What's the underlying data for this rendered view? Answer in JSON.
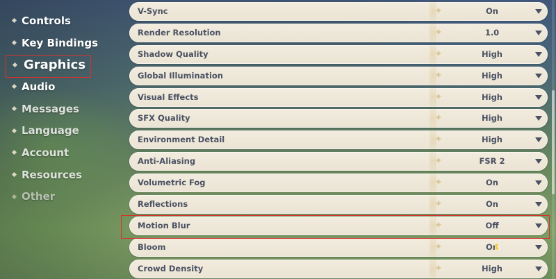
{
  "nav": {
    "items": [
      {
        "label": "Controls"
      },
      {
        "label": "Key Bindings"
      },
      {
        "label": "Graphics"
      },
      {
        "label": "Audio"
      },
      {
        "label": "Messages"
      },
      {
        "label": "Language"
      },
      {
        "label": "Account"
      },
      {
        "label": "Resources"
      },
      {
        "label": "Other"
      }
    ],
    "active": "Graphics"
  },
  "settings": {
    "rows": [
      {
        "label": "V-Sync",
        "value": "On"
      },
      {
        "label": "Render Resolution",
        "value": "1.0"
      },
      {
        "label": "Shadow Quality",
        "value": "High"
      },
      {
        "label": "Global Illumination",
        "value": "High"
      },
      {
        "label": "Visual Effects",
        "value": "High"
      },
      {
        "label": "SFX Quality",
        "value": "High"
      },
      {
        "label": "Environment Detail",
        "value": "High"
      },
      {
        "label": "Anti-Aliasing",
        "value": "FSR 2"
      },
      {
        "label": "Volumetric Fog",
        "value": "On"
      },
      {
        "label": "Reflections",
        "value": "On"
      },
      {
        "label": "Motion Blur",
        "value": "Off"
      },
      {
        "label": "Bloom",
        "value": "On"
      },
      {
        "label": "Crowd Density",
        "value": "High"
      }
    ],
    "highlighted": "Motion Blur"
  },
  "icons": {
    "nav_bullet": "diamond-bullet-icon",
    "row_ornament": "sparkle-icon",
    "dropdown": "chevron-down-icon"
  },
  "colors": {
    "highlight_box": "#d8312b",
    "row_bg": "#f2ecdf",
    "row_text": "#4a5162"
  }
}
